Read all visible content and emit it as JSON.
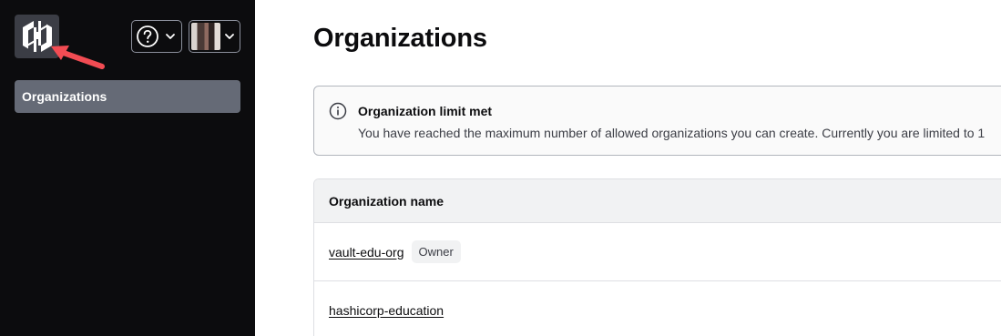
{
  "sidebar": {
    "nav_items": [
      {
        "label": "Organizations",
        "active": true
      }
    ]
  },
  "header": {
    "help_icon": "help-circle-icon",
    "user_menu_icon": "chevron-down-icon"
  },
  "main": {
    "title": "Organizations",
    "alert": {
      "icon": "info-icon",
      "title": "Organization limit met",
      "description": "You have reached the maximum number of allowed organizations you can create. Currently you are limited to 1"
    },
    "table": {
      "column_header": "Organization name",
      "rows": [
        {
          "name": "vault-edu-org",
          "badge": "Owner"
        },
        {
          "name": "hashicorp-education",
          "badge": ""
        }
      ]
    }
  },
  "colors": {
    "sidebar_bg": "#0c0c0e",
    "nav_active_bg": "#656a76",
    "arrow": "#f24c53"
  }
}
